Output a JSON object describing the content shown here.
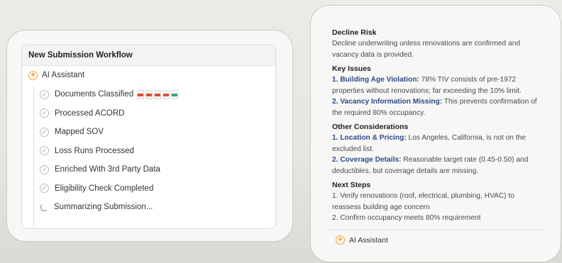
{
  "workflow": {
    "title": "New Submission Workflow",
    "ai_assistant_label": "AI Assistant",
    "steps": [
      {
        "label": "Documents Classified",
        "status": "done"
      },
      {
        "label": "Processed ACORD",
        "status": "done"
      },
      {
        "label": "Mapped SOV",
        "status": "done"
      },
      {
        "label": "Loss Runs Processed",
        "status": "done"
      },
      {
        "label": "Enriched With 3rd Party Data",
        "status": "done"
      },
      {
        "label": "Eligibility Check Completed",
        "status": "done"
      },
      {
        "label": "Summarizing Submission...",
        "status": "in-progress"
      }
    ],
    "document_icons": [
      {
        "icon": "pdf-file-icon",
        "color": "#e04a3b"
      },
      {
        "icon": "pdf-file-icon",
        "color": "#e04a3b"
      },
      {
        "icon": "pdf-file-icon",
        "color": "#e04a3b"
      },
      {
        "icon": "pdf-file-icon",
        "color": "#e04a3b"
      },
      {
        "icon": "spreadsheet-file-icon",
        "color": "#3aa57a"
      }
    ]
  },
  "analysis": {
    "decline_risk": {
      "title": "Decline Risk",
      "text": "Decline underwriting unless renovations are confirmed and vacancy data is provided."
    },
    "key_issues": {
      "title": "Key Issues",
      "items": [
        {
          "label": "1. Building Age Violation:",
          "text": " 78% TIV consists of pre-1972 properties without renovations; far exceeding the 10% limit."
        },
        {
          "label": "2. Vacancy Information Missing:",
          "text": " This prevents confirmation of the required 80% occupancy."
        }
      ]
    },
    "other_considerations": {
      "title": "Other Considerations",
      "items": [
        {
          "label": "1. Location & Pricing:",
          "text": " Los Angeles, California, is not on the excluded list."
        },
        {
          "label": "2. Coverage Details:",
          "text": " Reasonable target rate (0.45-0.50) and deductibles, but coverage details are missing."
        }
      ]
    },
    "next_steps": {
      "title": "Next Steps",
      "items": [
        "1. Verify renovations (roof, electrical, plumbing, HVAC) to reassess building age concern",
        "2. Confirm occupancy meets 80% requirement"
      ]
    },
    "ai_assistant_label": "AI Assistant"
  },
  "colors": {
    "accent_orange": "#f0a54a",
    "link_blue": "#2d4a8a"
  }
}
